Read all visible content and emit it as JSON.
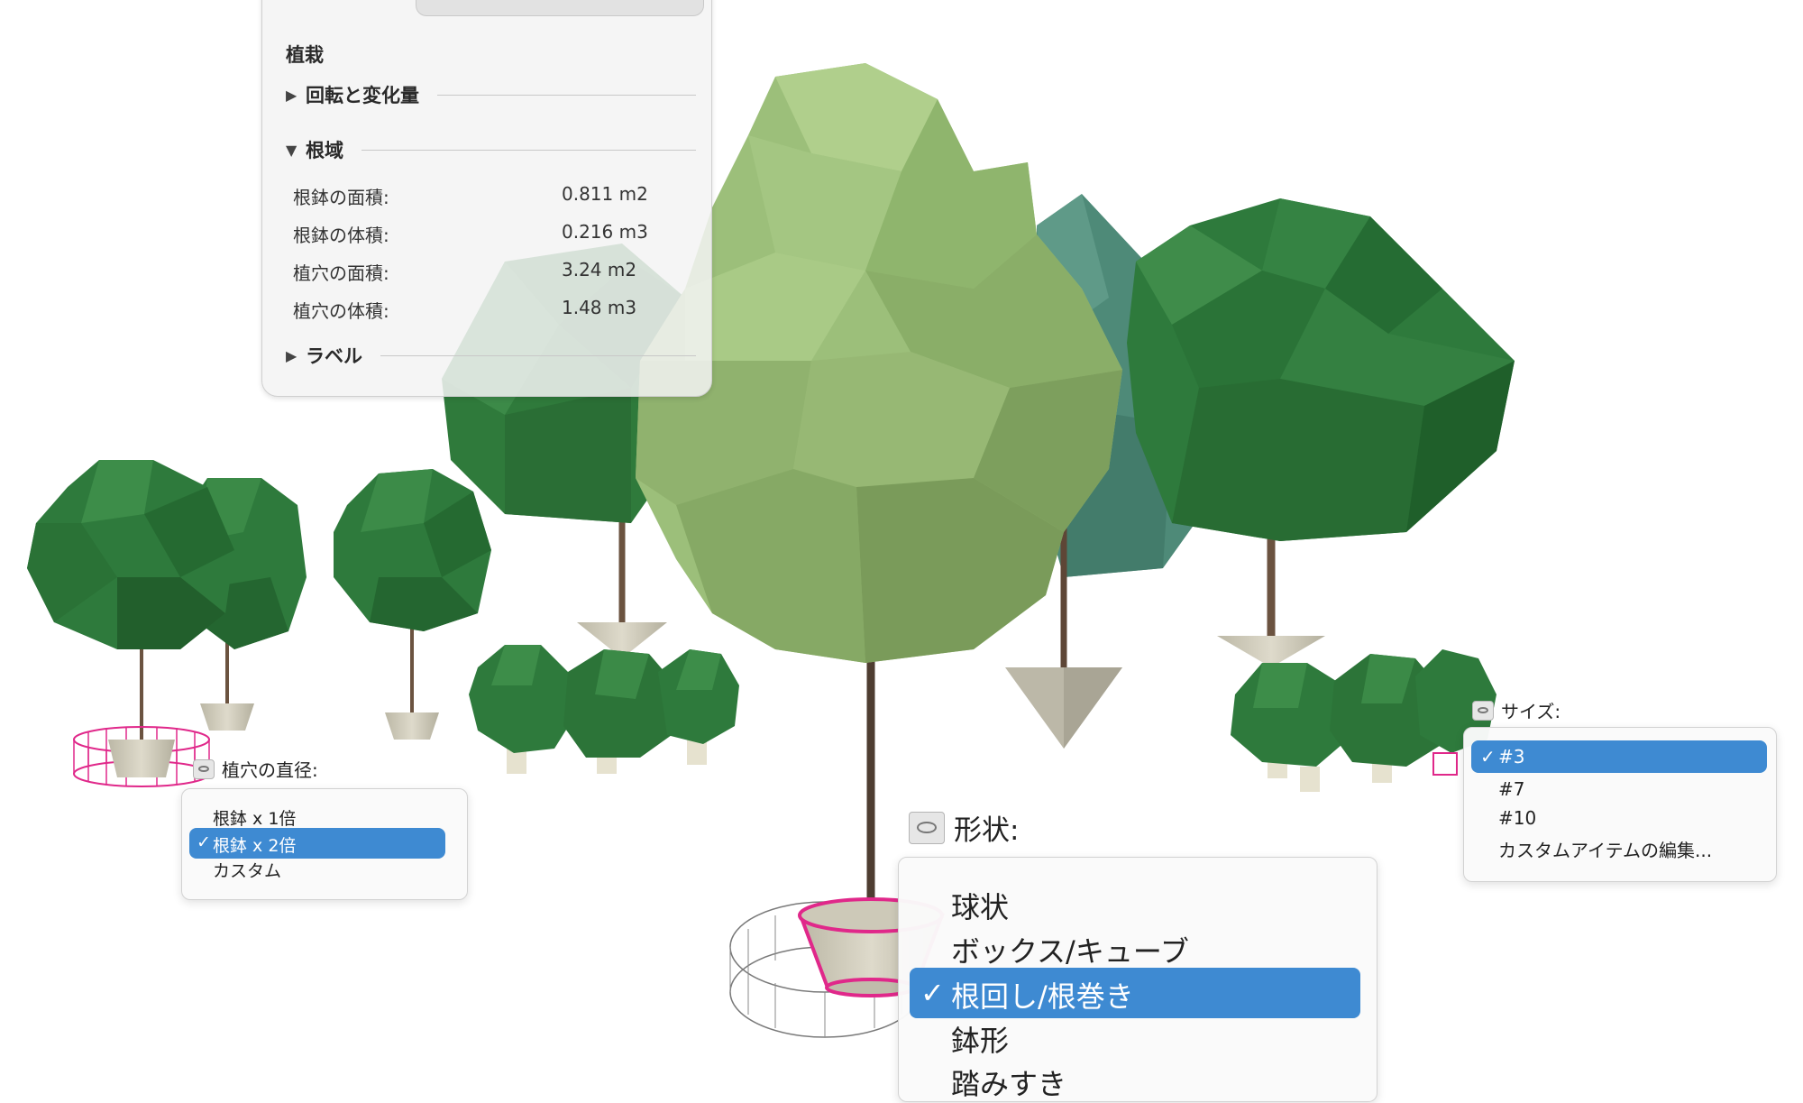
{
  "panel": {
    "title": "植栽",
    "sections": {
      "rotation": "回転と変化量",
      "root": "根域",
      "label": "ラベル"
    },
    "rows": [
      {
        "label": "根鉢の面積:",
        "value": "0.811 m2"
      },
      {
        "label": "根鉢の体積:",
        "value": "0.216 m3"
      },
      {
        "label": "植穴の面積:",
        "value": "3.24 m2"
      },
      {
        "label": "植穴の体積:",
        "value": "1.48 m3"
      }
    ]
  },
  "diameter_menu": {
    "label": "植穴の直径:",
    "icon": "parameter-icon",
    "items": [
      "根鉢 x 1倍",
      "根鉢 x 2倍",
      "カスタム"
    ],
    "selected": "根鉢 x 2倍"
  },
  "shape_menu": {
    "label": "形状:",
    "icon": "parameter-icon",
    "items": [
      "球状",
      "ボックス/キューブ",
      "根回し/根巻き",
      "鉢形",
      "踏みすき"
    ],
    "selected": "根回し/根巻き"
  },
  "size_menu": {
    "label": "サイズ:",
    "icon": "parameter-icon",
    "items": [
      "#3",
      "#7",
      "#10",
      "カスタムアイテムの編集..."
    ],
    "selected": "#3"
  },
  "colors": {
    "highlight": "#3e8ad2",
    "root_ball_outline": "#e0288a",
    "tree_dark": "#2e7a3c",
    "tree_light": "#9cbf7a",
    "tree_teal": "#4e8a78",
    "root_ball": "#d3cfbf"
  },
  "check_mark": "✓"
}
